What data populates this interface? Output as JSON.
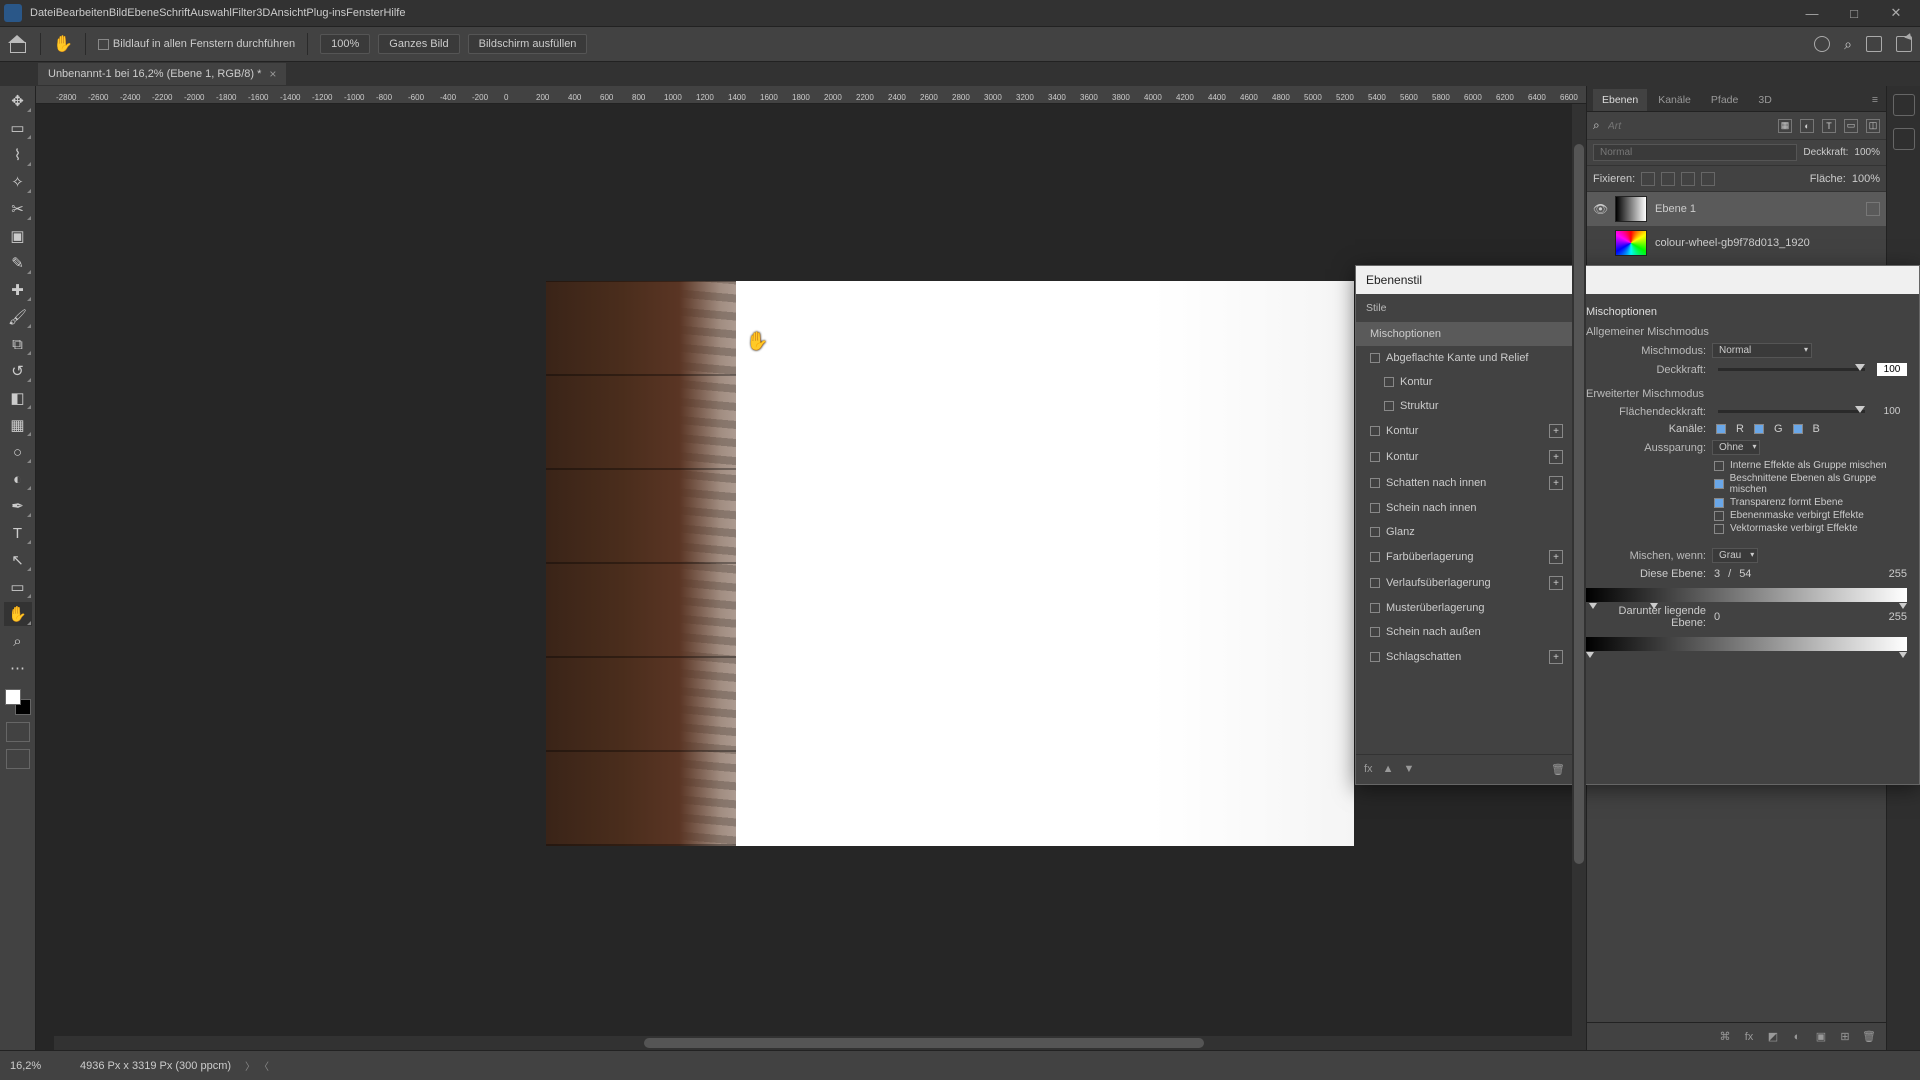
{
  "window": {
    "min": "—",
    "max": "□",
    "close": "✕"
  },
  "menu": [
    "Datei",
    "Bearbeiten",
    "Bild",
    "Ebene",
    "Schrift",
    "Auswahl",
    "Filter",
    "3D",
    "Ansicht",
    "Plug-ins",
    "Fenster",
    "Hilfe"
  ],
  "optbar": {
    "scroll_all": "Bildlauf in allen Fenstern durchführen",
    "b100": "100%",
    "bfit": "Ganzes Bild",
    "bfill": "Bildschirm ausfüllen"
  },
  "tab": {
    "title": "Unbenannt-1 bei 16,2% (Ebene 1, RGB/8) *"
  },
  "ruler_marks": [
    "0",
    "-2800",
    "-2600",
    "-2400",
    "-2200",
    "-2000",
    "-1800",
    "-1600",
    "-1400",
    "-1200",
    "-1000",
    "-800",
    "-600",
    "-400",
    "-200",
    "0",
    "200",
    "400",
    "600",
    "800",
    "1000",
    "1200",
    "1400",
    "1600",
    "1800",
    "2000",
    "2200",
    "2400",
    "2600",
    "2800",
    "3000",
    "3200",
    "3400",
    "3600",
    "3800",
    "4000",
    "4200",
    "4400",
    "4600",
    "4800",
    "5000",
    "5200",
    "5400",
    "5600",
    "5800",
    "6000",
    "6200",
    "6400",
    "6600"
  ],
  "panels": {
    "tabs": [
      "Ebenen",
      "Kanäle",
      "Pfade",
      "3D"
    ],
    "search_ph": "Art",
    "blend": {
      "mode": "Normal",
      "opacity_lbl": "Deckkraft:",
      "opacity_val": "100%"
    },
    "lockrow": {
      "lbl": "Fixieren:",
      "fill_lbl": "Fläche:",
      "fill_val": "100%"
    },
    "layers": [
      {
        "name": "Ebene 1",
        "vis": true,
        "thumb": "grad",
        "sel": true
      },
      {
        "name": "colour-wheel-gb9f78d013_1920",
        "vis": false,
        "thumb": "wheel"
      }
    ]
  },
  "dialog": {
    "title": "Ebenenstil",
    "styles_hdr": "Stile",
    "left": [
      {
        "label": "Mischoptionen",
        "sel": true
      },
      {
        "label": "Abgeflachte Kante und Relief",
        "cb": true
      },
      {
        "label": "Kontur",
        "cb": true,
        "indent": true
      },
      {
        "label": "Struktur",
        "cb": true,
        "indent": true
      },
      {
        "label": "Kontur",
        "cb": true,
        "plus": true
      },
      {
        "label": "Kontur",
        "cb": true,
        "plus": true
      },
      {
        "label": "Schatten nach innen",
        "cb": true,
        "plus": true
      },
      {
        "label": "Schein nach innen",
        "cb": true
      },
      {
        "label": "Glanz",
        "cb": true
      },
      {
        "label": "Farbüberlagerung",
        "cb": true,
        "plus": true
      },
      {
        "label": "Verlaufsüberlagerung",
        "cb": true,
        "plus": true
      },
      {
        "label": "Musterüberlagerung",
        "cb": true
      },
      {
        "label": "Schein nach außen",
        "cb": true
      },
      {
        "label": "Schlagschatten",
        "cb": true,
        "plus": true
      }
    ],
    "right": {
      "sect": "Mischoptionen",
      "g1": "Allgemeiner Mischmodus",
      "mode_lbl": "Mischmodus:",
      "mode_val": "Normal",
      "op_lbl": "Deckkraft:",
      "op_val": "100",
      "g2": "Erweiterter Mischmodus",
      "fill_lbl": "Flächendeckkraft:",
      "fill_val": "100",
      "chan_lbl": "Kanäle:",
      "chan": [
        "R",
        "G",
        "B"
      ],
      "knock_lbl": "Aussparung:",
      "knock_val": "Ohne",
      "checks": [
        {
          "on": false,
          "t": "Interne Effekte als Gruppe mischen"
        },
        {
          "on": true,
          "t": "Beschnittene Ebenen als Gruppe mischen"
        },
        {
          "on": true,
          "t": "Transparenz formt Ebene"
        },
        {
          "on": false,
          "t": "Ebenenmaske verbirgt Effekte"
        },
        {
          "on": false,
          "t": "Vektormaske verbirgt Effekte"
        }
      ],
      "blendif_lbl": "Mischen, wenn:",
      "blendif_val": "Grau",
      "this_lbl": "Diese Ebene:",
      "this_vals": [
        "3",
        "/",
        "54",
        "255"
      ],
      "under_lbl": "Darunter liegende Ebene:",
      "under_vals": [
        "0",
        "255"
      ]
    }
  },
  "status": {
    "zoom": "16,2%",
    "doc": "4936 Px x 3319 Px (300 ppcm)"
  }
}
